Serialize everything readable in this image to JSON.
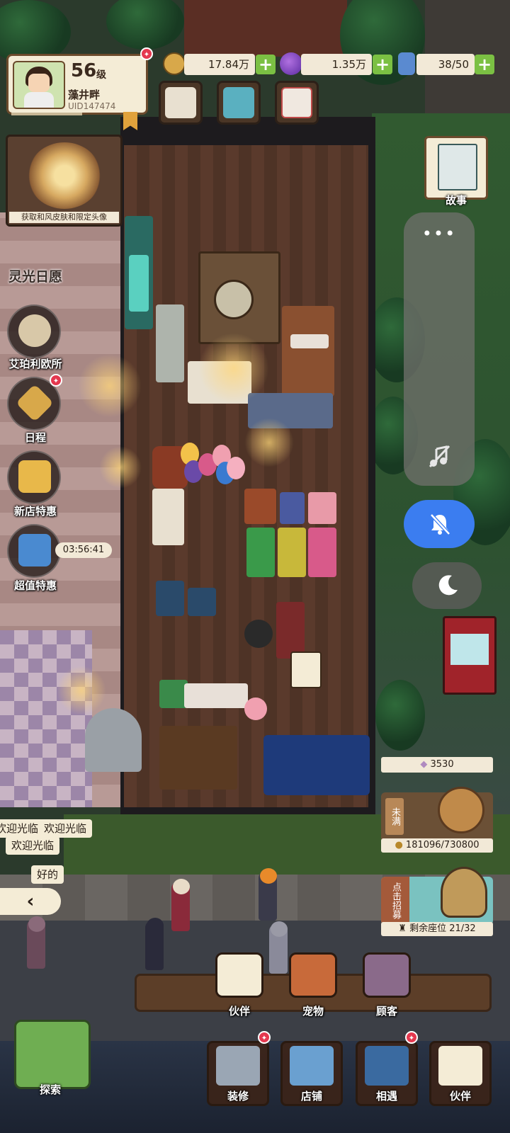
{
  "player": {
    "level": "56",
    "level_unit": "级",
    "name": "藻井畔",
    "uid": "UID147474"
  },
  "currencies": {
    "coins": "17.84万",
    "gems": "1.35万",
    "energy": "38/50"
  },
  "events": {
    "banner_caption": "获取和风皮肤和限定头像",
    "banner_title": "灵光日愿",
    "items": [
      {
        "label": "艾珀利欧所"
      },
      {
        "label": "日程"
      },
      {
        "label": "新店特惠"
      },
      {
        "label": "超值特惠"
      }
    ],
    "countdown": "03:56:41"
  },
  "story": {
    "label": "故事"
  },
  "panel": {
    "more": "•••"
  },
  "shop_stats": {
    "hearts": "3530",
    "piggy_tag": "未满",
    "coins_progress": "181096/730800",
    "recruit_tag": "点击招募",
    "seats": "剩余座位 21/32"
  },
  "bubbles": {
    "welcome_1": "欢迎光临",
    "welcome_2": "欢迎光临",
    "welcome_3": "欢迎光临",
    "ok": "好的",
    "back": "‹"
  },
  "mid_actions": [
    {
      "label": "伙伴"
    },
    {
      "label": "宠物"
    },
    {
      "label": "顾客"
    }
  ],
  "bottom_nav": {
    "explore": "探索",
    "items": [
      {
        "label": "装修"
      },
      {
        "label": "店铺"
      },
      {
        "label": "相遇"
      },
      {
        "label": "伙伴"
      }
    ]
  },
  "colors": {
    "accent_green": "#7bc043",
    "notify_red": "#e5384f",
    "dnd_blue": "#3b7df0",
    "panel_cream": "#f4ecd6"
  }
}
